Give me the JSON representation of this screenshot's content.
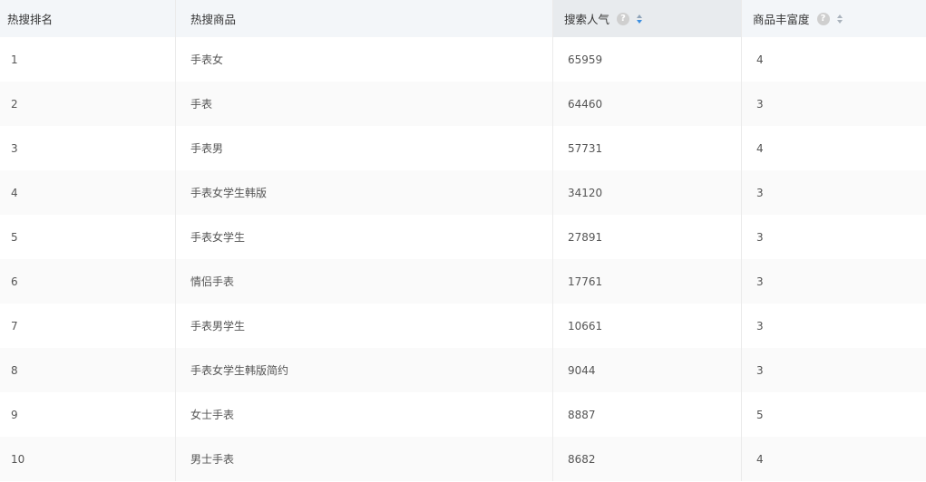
{
  "table": {
    "headers": {
      "rank": "热搜排名",
      "product": "热搜商品",
      "popularity": "搜索人气",
      "richness": "商品丰富度"
    },
    "rows": [
      {
        "rank": "1",
        "product": "手表女",
        "popularity": "65959",
        "richness": "4"
      },
      {
        "rank": "2",
        "product": "手表",
        "popularity": "64460",
        "richness": "3"
      },
      {
        "rank": "3",
        "product": "手表男",
        "popularity": "57731",
        "richness": "4"
      },
      {
        "rank": "4",
        "product": "手表女学生韩版",
        "popularity": "34120",
        "richness": "3"
      },
      {
        "rank": "5",
        "product": "手表女学生",
        "popularity": "27891",
        "richness": "3"
      },
      {
        "rank": "6",
        "product": "情侣手表",
        "popularity": "17761",
        "richness": "3"
      },
      {
        "rank": "7",
        "product": "手表男学生",
        "popularity": "10661",
        "richness": "3"
      },
      {
        "rank": "8",
        "product": "手表女学生韩版简约",
        "popularity": "9044",
        "richness": "3"
      },
      {
        "rank": "9",
        "product": "女士手表",
        "popularity": "8887",
        "richness": "5"
      },
      {
        "rank": "10",
        "product": "男士手表",
        "popularity": "8682",
        "richness": "4"
      }
    ]
  },
  "icons": {
    "help": "?",
    "help_name": "question-mark-icon",
    "sort_name": "sort-icon"
  },
  "colors": {
    "header_bg": "#f3f6f9",
    "sorted_column_bg": "#e8ebee",
    "sort_active": "#3d8fe0",
    "alt_row_bg": "#fafafa"
  }
}
